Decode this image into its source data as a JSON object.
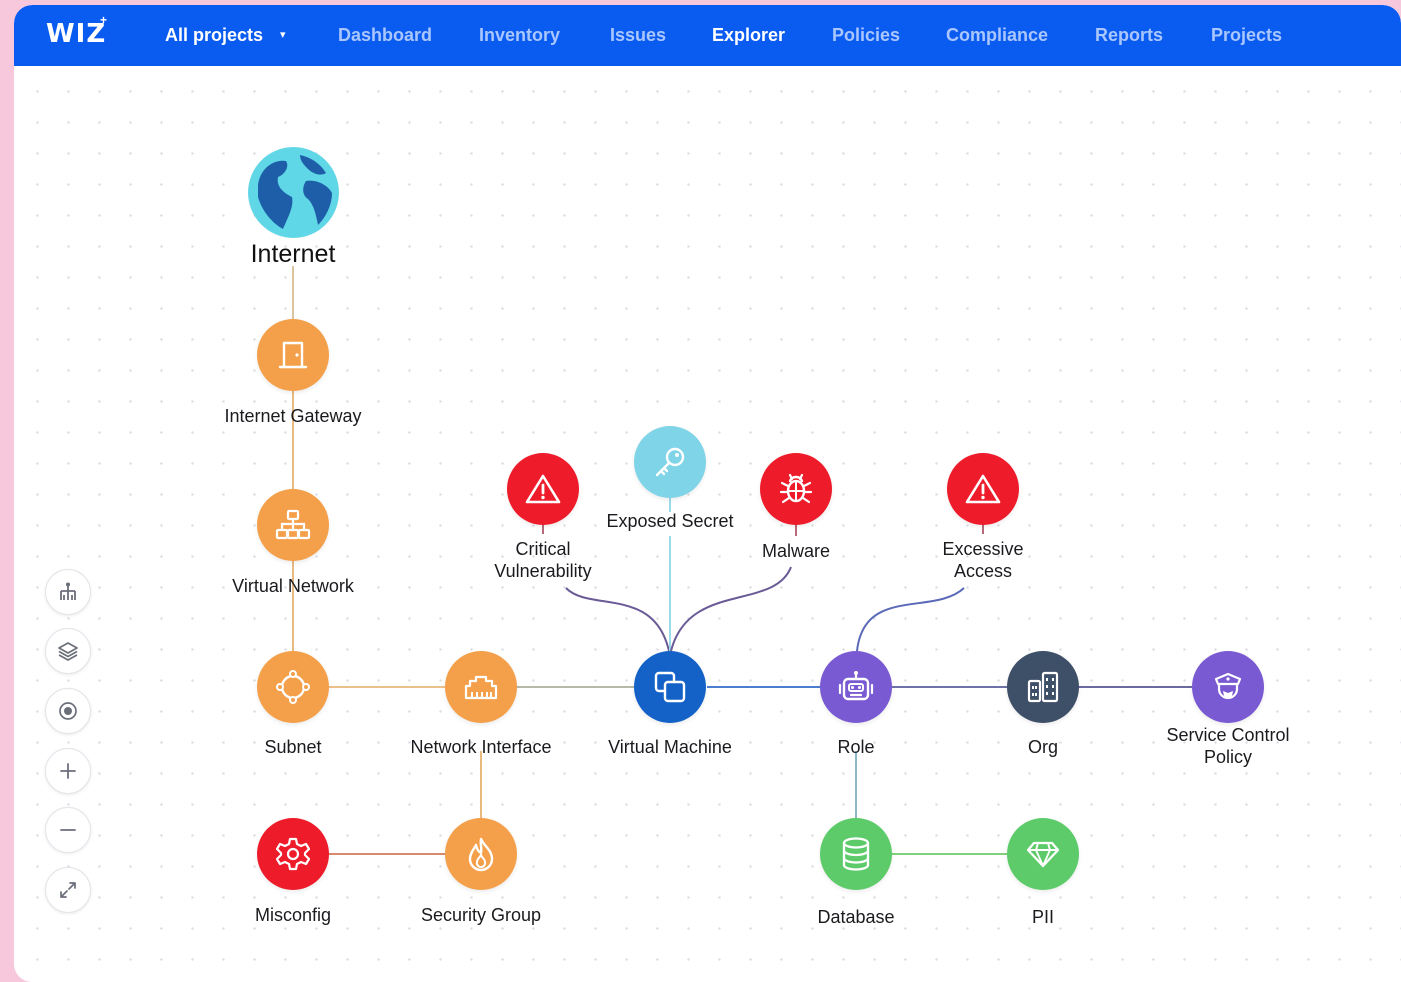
{
  "brand": {
    "logo_text": "WIZ",
    "logo_mark": "+"
  },
  "header": {
    "projects_label": "All projects",
    "projects_caret": "▾",
    "nav": [
      "Dashboard",
      "Inventory",
      "Issues",
      "Explorer",
      "Policies",
      "Compliance",
      "Reports",
      "Projects"
    ],
    "active_nav": "Explorer"
  },
  "graph": {
    "nodes": {
      "internet": {
        "label": "Internet",
        "icon": "globe-icon"
      },
      "internet_gateway": {
        "label": "Internet Gateway",
        "icon": "door-icon",
        "color": "#f4a04b"
      },
      "virtual_network": {
        "label": "Virtual Network",
        "icon": "network-icon",
        "color": "#f4a04b"
      },
      "subnet": {
        "label": "Subnet",
        "icon": "subnet-icon",
        "color": "#f4a04b"
      },
      "network_interface": {
        "label": "Network Interface",
        "icon": "ethernet-icon",
        "color": "#f4a04b"
      },
      "security_group": {
        "label": "Security Group",
        "icon": "flame-icon",
        "color": "#f4a04b"
      },
      "misconfig": {
        "label": "Misconfig",
        "icon": "gear-icon",
        "color": "#ee1c2b"
      },
      "critical_vulnerability": {
        "label_line1": "Critical",
        "label_line2": "Vulnerability",
        "icon": "warning-icon",
        "color": "#ee1c2b"
      },
      "exposed_secret": {
        "label": "Exposed Secret",
        "icon": "key-icon",
        "color": "#7fd4e8"
      },
      "malware": {
        "label": "Malware",
        "icon": "bug-icon",
        "color": "#ee1c2b"
      },
      "virtual_machine": {
        "label": "Virtual Machine",
        "icon": "vm-icon",
        "color": "#1462c8"
      },
      "excessive_access": {
        "label_line1": "Excessive",
        "label_line2": "Access",
        "icon": "warning-icon",
        "color": "#ee1c2b"
      },
      "role": {
        "label": "Role",
        "icon": "robot-icon",
        "color": "#7a5ad2"
      },
      "org": {
        "label": "Org",
        "icon": "building-icon",
        "color": "#3e4f68"
      },
      "service_control_policy": {
        "label_line1": "Service Control",
        "label_line2": "Policy",
        "icon": "police-icon",
        "color": "#7a5ad2"
      },
      "database": {
        "label": "Database",
        "icon": "database-icon",
        "color": "#5ecb6a"
      },
      "pii": {
        "label": "PII",
        "icon": "diamond-icon",
        "color": "#5ecb6a"
      }
    }
  },
  "controls": [
    "hierarchy-icon",
    "layers-icon",
    "target-icon",
    "zoom-in-icon",
    "zoom-out-icon",
    "expand-icon"
  ]
}
